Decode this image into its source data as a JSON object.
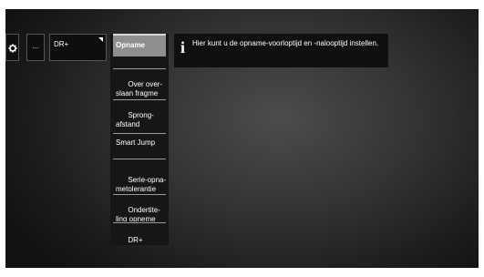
{
  "tabs": {
    "gear_icon": "gear-icon",
    "more_label": "...",
    "dr_label": "DR+"
  },
  "menu": {
    "items": [
      {
        "label": "Opname"
      },
      {
        "label": "Over over-\nslaan fragme"
      },
      {
        "label": "Sprong-\nafstand"
      },
      {
        "label": "Smart Jump"
      },
      {
        "label": "Serie-opna-\nmetolerantie"
      },
      {
        "label": "Ondertite-\nling opneme"
      },
      {
        "label": "DR+\nStreaming"
      }
    ]
  },
  "info": {
    "icon": "info-icon",
    "text": "Hier kunt u de opname-voorloptijd en -nalooptijd instellen."
  }
}
